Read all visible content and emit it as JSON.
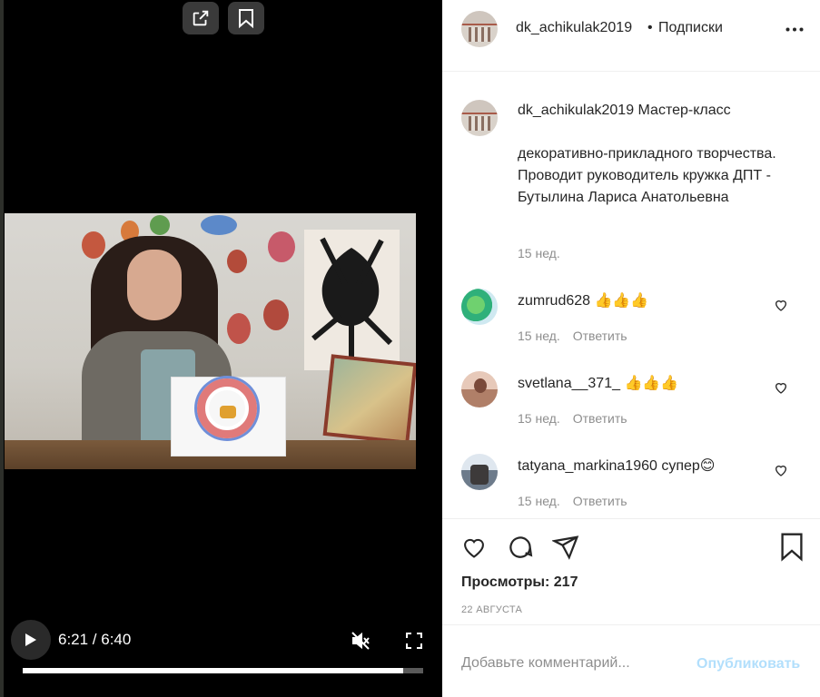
{
  "video": {
    "time_display": "6:21 / 6:40",
    "progress_fraction": 0.95,
    "muted": true
  },
  "header": {
    "username": "dk_achikulak2019",
    "separator": "•",
    "follow_label": "Подписки"
  },
  "caption": {
    "username": "dk_achikulak2019",
    "text_first": "Мастер-класс",
    "text_rest": "декоративно-прикладного творчества. Проводит руководитель кружка ДПТ - Бутылина Лариса Анатольевна",
    "time": "15 нед."
  },
  "comments": [
    {
      "username": "zumrud628",
      "text": "👍👍👍",
      "time": "15 нед.",
      "reply_label": "Ответить"
    },
    {
      "username": "svetlana__371_",
      "text": "👍👍👍",
      "time": "15 нед.",
      "reply_label": "Ответить"
    },
    {
      "username": "tatyana_markina1960",
      "text": "супер😊",
      "time": "15 нед.",
      "reply_label": "Ответить"
    }
  ],
  "actions": {
    "views": "Просмотры: 217",
    "date": "22 АВГУСТА"
  },
  "add_comment": {
    "placeholder": "Добавьте комментарий...",
    "publish_label": "Опубликовать"
  },
  "icons": [
    "open-link-icon",
    "bookmark-icon",
    "play-icon",
    "mute-icon",
    "fullscreen-icon",
    "more-icon",
    "heart-icon",
    "comment-icon",
    "share-icon",
    "save-icon"
  ],
  "colors": {
    "text": "#262626",
    "secondary": "#8e8e8e",
    "publish_disabled": "#b2dffc"
  }
}
